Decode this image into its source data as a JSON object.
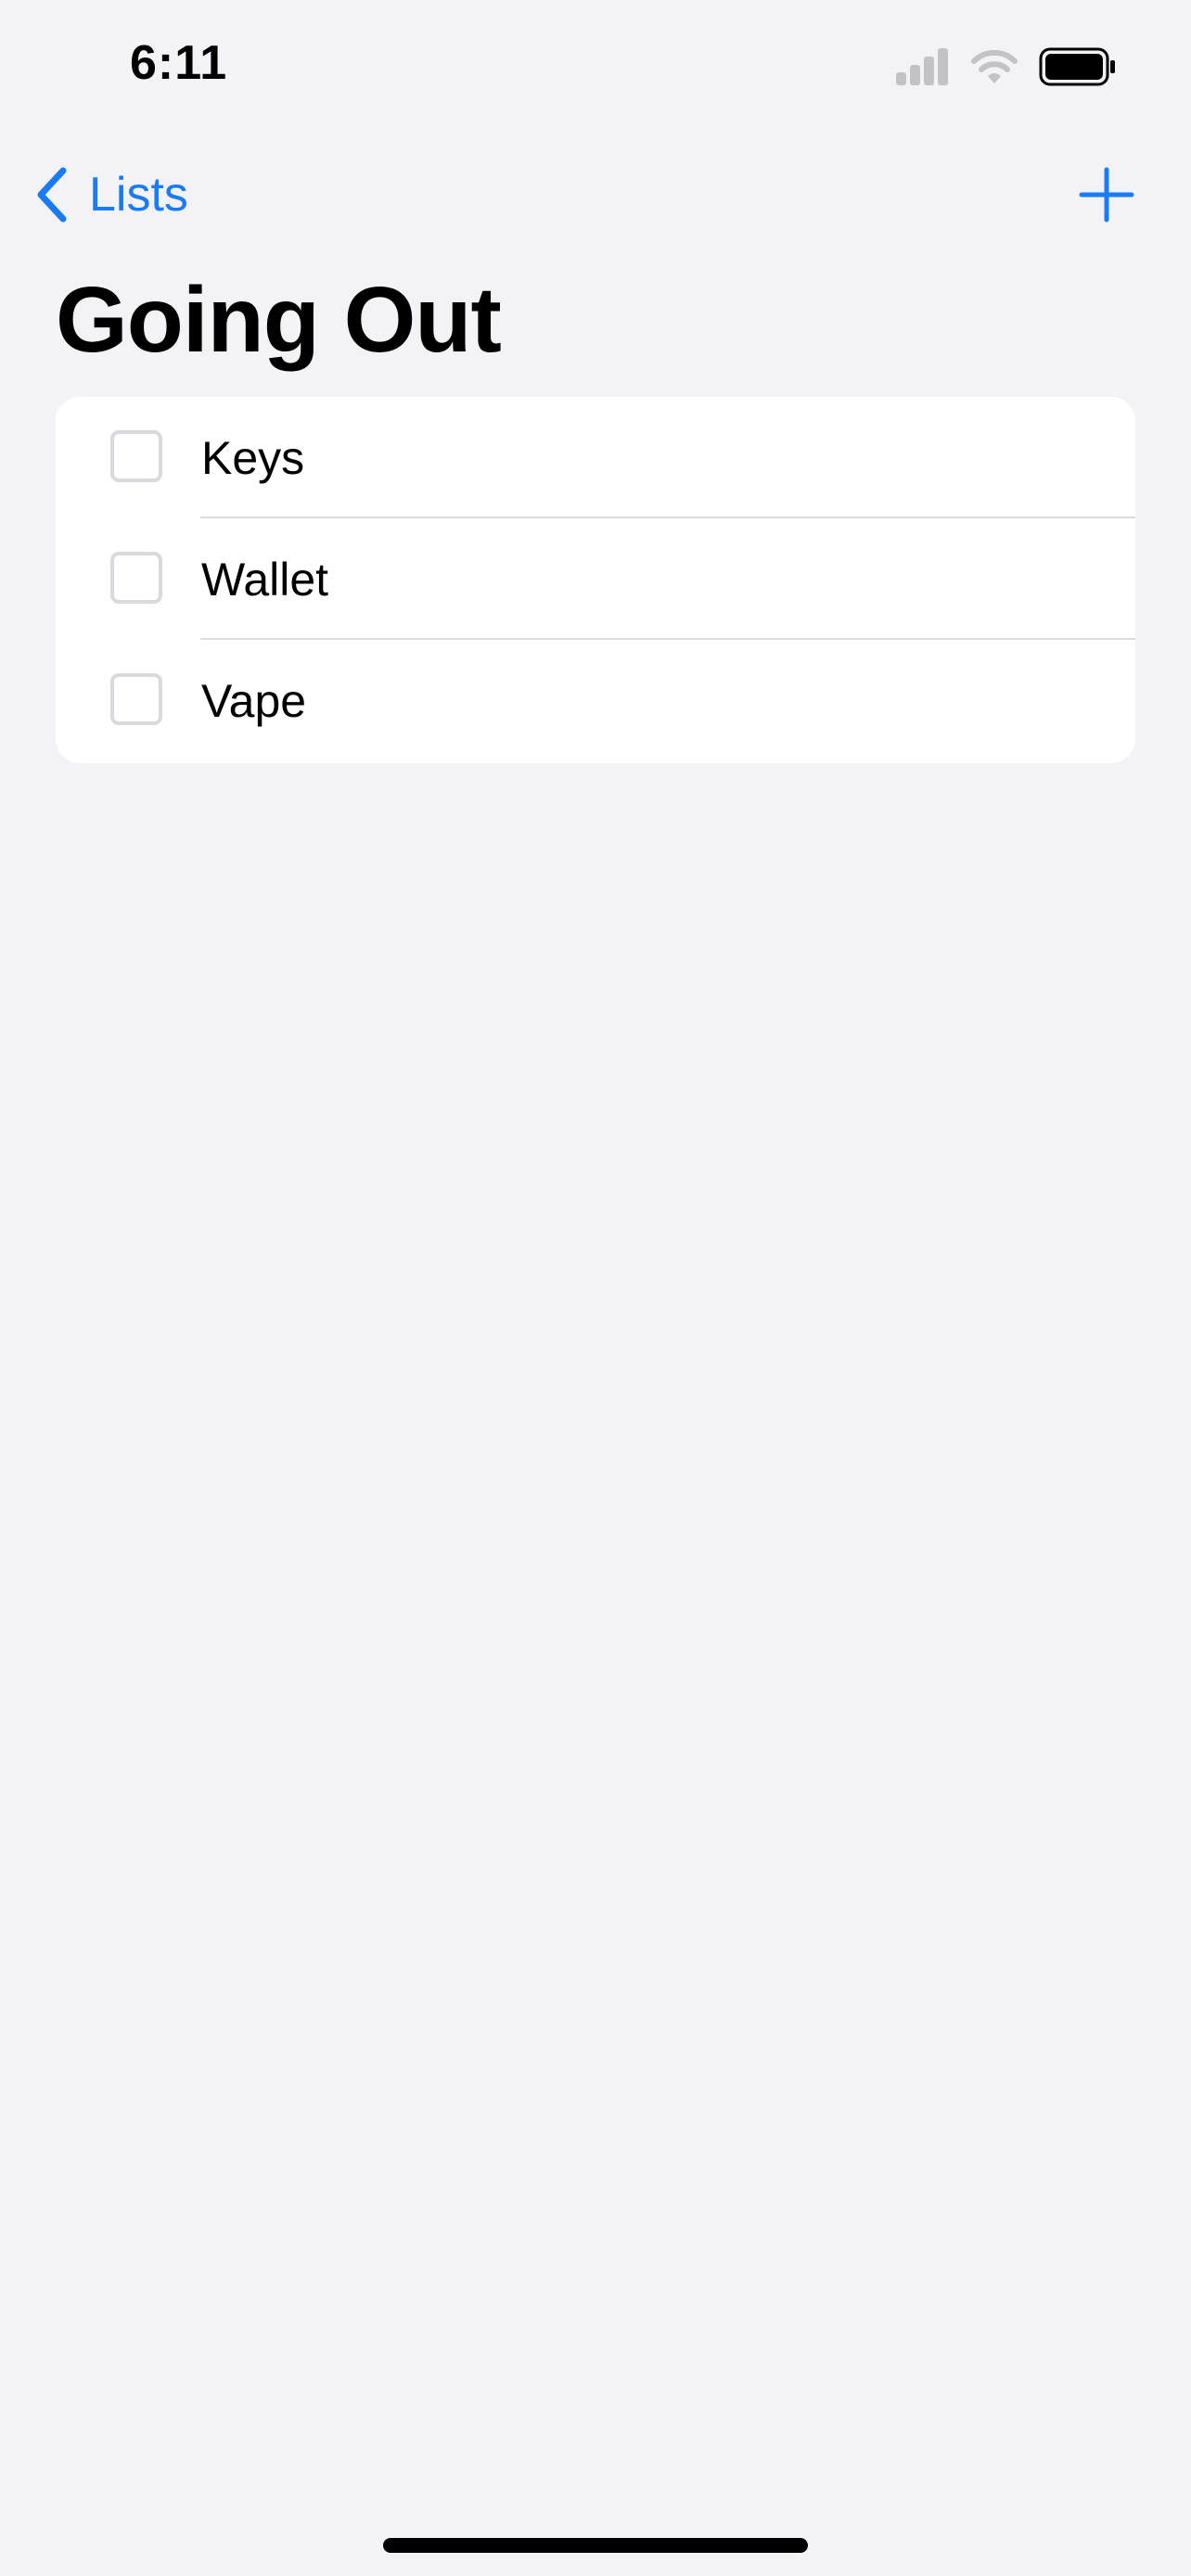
{
  "status_bar": {
    "time": "6:11",
    "icons": [
      "cellular-signal-icon",
      "wifi-icon",
      "battery-icon"
    ]
  },
  "nav": {
    "back_label": "Lists",
    "back_icon": "chevron-left-icon",
    "add_icon": "plus-icon"
  },
  "list": {
    "title": "Going Out",
    "items": [
      {
        "label": "Keys",
        "checked": false
      },
      {
        "label": "Wallet",
        "checked": false
      },
      {
        "label": "Vape",
        "checked": false
      }
    ]
  },
  "colors": {
    "accent": "#1a7cf5",
    "background": "#f2f2f7",
    "card": "#ffffff"
  }
}
